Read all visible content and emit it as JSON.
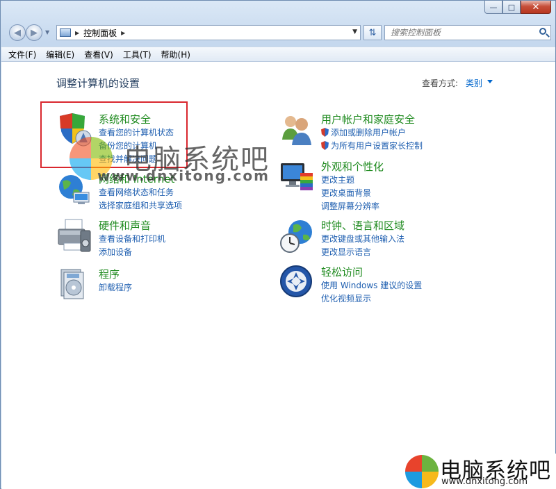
{
  "window": {
    "caption_buttons": [
      "minimize-icon",
      "maximize-icon",
      "close-icon"
    ]
  },
  "address_bar": {
    "path": "控制面板",
    "search_placeholder": "搜索控制面板"
  },
  "menu": [
    "文件(F)",
    "编辑(E)",
    "查看(V)",
    "工具(T)",
    "帮助(H)"
  ],
  "content": {
    "title": "调整计算机的设置",
    "view_by_label": "查看方式:",
    "view_by_value": "类别"
  },
  "categories": [
    {
      "title": "系统和安全",
      "icon": "shield-icon",
      "links": [
        "查看您的计算机状态",
        "备份您的计算机",
        "查找并解决问题"
      ]
    },
    {
      "title": "网络和 Internet",
      "icon": "network-globe-icon",
      "links": [
        "查看网络状态和任务",
        "选择家庭组和共享选项"
      ]
    },
    {
      "title": "硬件和声音",
      "icon": "printer-icon",
      "links": [
        "查看设备和打印机",
        "添加设备"
      ]
    },
    {
      "title": "程序",
      "icon": "programs-icon",
      "links": [
        "卸载程序"
      ]
    },
    {
      "title": "用户帐户和家庭安全",
      "icon": "users-icon",
      "links": [
        "添加或删除用户帐户",
        "为所有用户设置家长控制"
      ]
    },
    {
      "title": "外观和个性化",
      "icon": "monitor-palette-icon",
      "links": [
        "更改主题",
        "更改桌面背景",
        "调整屏幕分辨率"
      ]
    },
    {
      "title": "时钟、语言和区域",
      "icon": "clock-globe-icon",
      "links": [
        "更改键盘或其他输入法",
        "更改显示语言"
      ]
    },
    {
      "title": "轻松访问",
      "icon": "ease-of-access-icon",
      "links": [
        "使用 Windows 建议的设置",
        "优化视频显示"
      ]
    }
  ],
  "watermark": {
    "name": "电脑系统吧",
    "url": "www.dnxitong.com",
    "corner_url": "www.dnxitong.com"
  }
}
